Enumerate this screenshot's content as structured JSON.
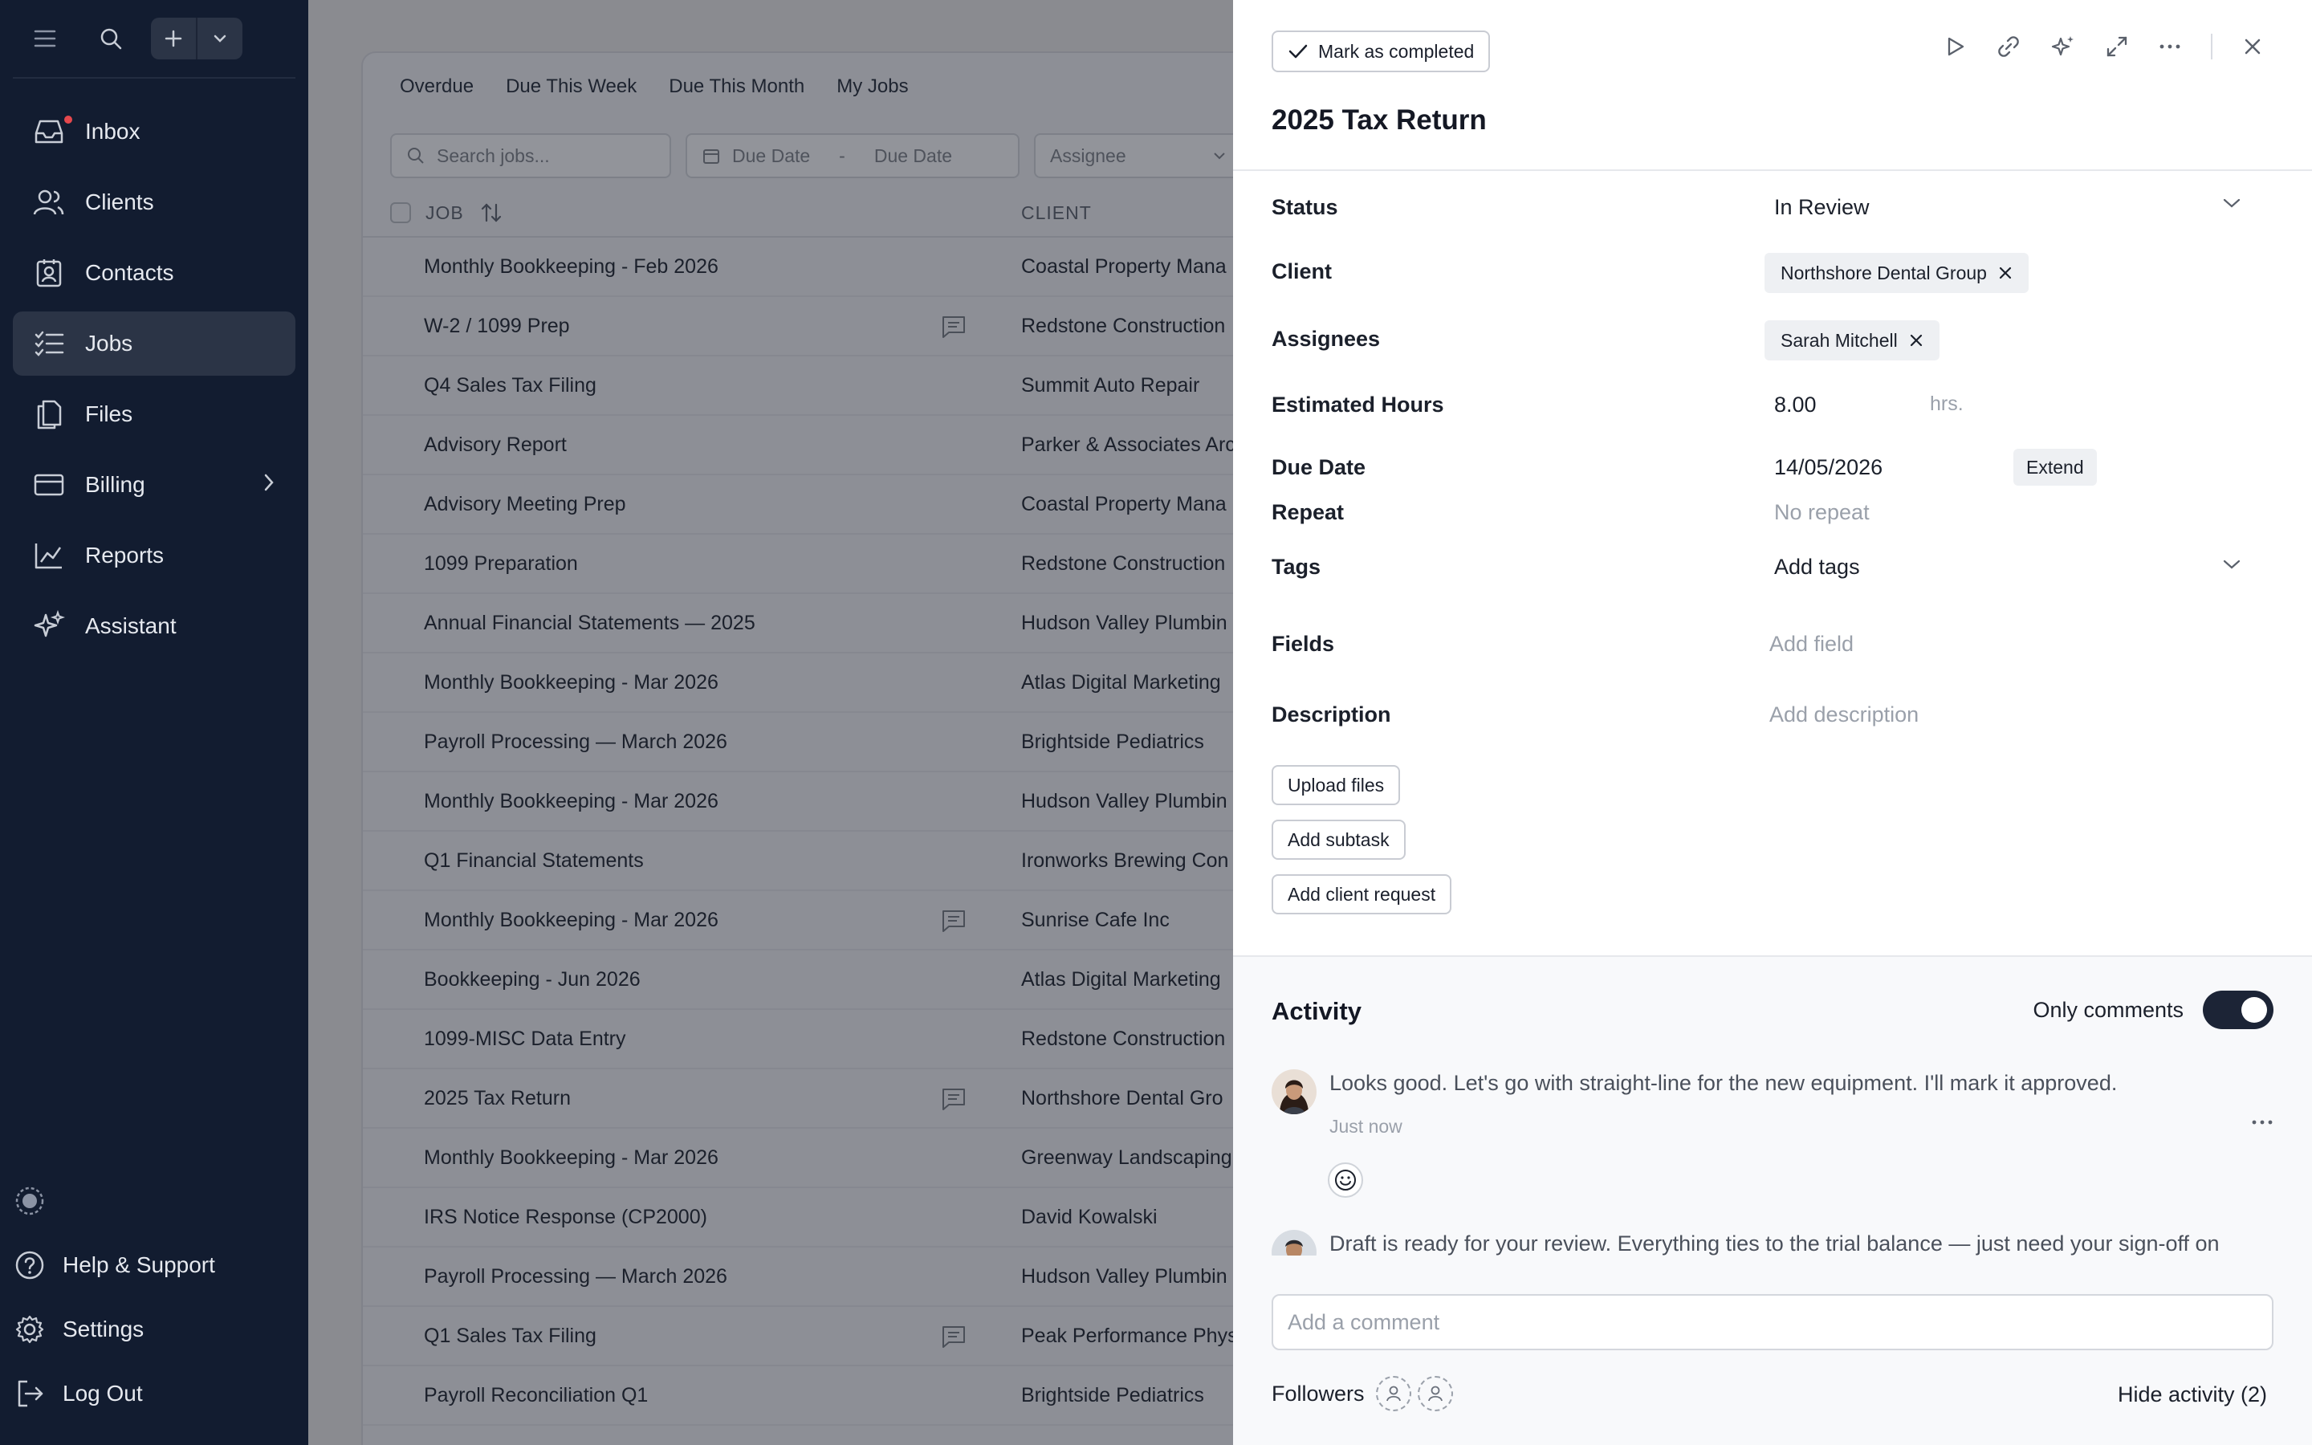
{
  "sidebar": {
    "nav": [
      {
        "label": "Inbox",
        "icon": "inbox-icon"
      },
      {
        "label": "Clients",
        "icon": "clients-icon"
      },
      {
        "label": "Contacts",
        "icon": "contacts-icon"
      },
      {
        "label": "Jobs",
        "icon": "jobs-icon"
      },
      {
        "label": "Files",
        "icon": "files-icon"
      },
      {
        "label": "Billing",
        "icon": "billing-icon"
      },
      {
        "label": "Reports",
        "icon": "reports-icon"
      },
      {
        "label": "Assistant",
        "icon": "assistant-icon"
      }
    ],
    "bottom": [
      {
        "label": "Help & Support",
        "icon": "help-icon"
      },
      {
        "label": "Settings",
        "icon": "gear-icon"
      },
      {
        "label": "Log Out",
        "icon": "logout-icon"
      }
    ]
  },
  "jobs": {
    "tabs": [
      "Overdue",
      "Due This Week",
      "Due This Month",
      "My Jobs"
    ],
    "search_placeholder": "Search jobs...",
    "due_from": "Due Date",
    "due_sep": "-",
    "due_to": "Due Date",
    "assignee": "Assignee",
    "col_job": "JOB",
    "col_client": "CLIENT",
    "rows": [
      {
        "job": "Monthly Bookkeeping - Feb 2026",
        "client": "Coastal Property Mana",
        "comment": false
      },
      {
        "job": "W-2 / 1099 Prep",
        "client": "Redstone Construction",
        "comment": true
      },
      {
        "job": "Q4 Sales Tax Filing",
        "client": "Summit Auto Repair",
        "comment": false
      },
      {
        "job": "Advisory Report",
        "client": "Parker & Associates Arc",
        "comment": false
      },
      {
        "job": "Advisory Meeting Prep",
        "client": "Coastal Property Mana",
        "comment": false
      },
      {
        "job": "1099 Preparation",
        "client": "Redstone Construction",
        "comment": false
      },
      {
        "job": "Annual Financial Statements — 2025",
        "client": "Hudson Valley Plumbin",
        "comment": false
      },
      {
        "job": "Monthly Bookkeeping - Mar 2026",
        "client": "Atlas Digital Marketing",
        "comment": false
      },
      {
        "job": "Payroll Processing — March 2026",
        "client": "Brightside Pediatrics",
        "comment": false
      },
      {
        "job": "Monthly Bookkeeping - Mar 2026",
        "client": "Hudson Valley Plumbin",
        "comment": false
      },
      {
        "job": "Q1 Financial Statements",
        "client": "Ironworks Brewing Con",
        "comment": false
      },
      {
        "job": "Monthly Bookkeeping - Mar 2026",
        "client": "Sunrise Cafe Inc",
        "comment": true
      },
      {
        "job": "Bookkeeping - Jun 2026",
        "client": "Atlas Digital Marketing",
        "comment": false
      },
      {
        "job": "1099-MISC Data Entry",
        "client": "Redstone Construction",
        "comment": false
      },
      {
        "job": "2025 Tax Return",
        "client": "Northshore Dental Gro",
        "comment": true
      },
      {
        "job": "Monthly Bookkeeping - Mar 2026",
        "client": "Greenway Landscaping",
        "comment": false
      },
      {
        "job": "IRS Notice Response (CP2000)",
        "client": "David Kowalski",
        "comment": false
      },
      {
        "job": "Payroll Processing — March 2026",
        "client": "Hudson Valley Plumbin",
        "comment": false
      },
      {
        "job": "Q1 Sales Tax Filing",
        "client": "Peak Performance Phys",
        "comment": true
      },
      {
        "job": "Payroll Reconciliation Q1",
        "client": "Brightside Pediatrics",
        "comment": false
      }
    ]
  },
  "detail": {
    "mark_completed": "Mark as completed",
    "title": "2025 Tax Return",
    "fields": {
      "status_label": "Status",
      "status_value": "In Review",
      "client_label": "Client",
      "client_value": "Northshore Dental Group",
      "assignees_label": "Assignees",
      "assignee_value": "Sarah Mitchell",
      "hours_label": "Estimated Hours",
      "hours_value": "8.00",
      "hours_unit": "hrs.",
      "due_label": "Due Date",
      "due_value": "14/05/2026",
      "extend": "Extend",
      "repeat_label": "Repeat",
      "repeat_value": "No repeat",
      "tags_label": "Tags",
      "tags_value": "Add tags",
      "fields_label": "Fields",
      "fields_value": "Add field",
      "desc_label": "Description",
      "desc_value": "Add description"
    },
    "buttons": {
      "upload": "Upload files",
      "subtask": "Add subtask",
      "client_request": "Add client request"
    }
  },
  "activity": {
    "title": "Activity",
    "only_comments": "Only comments",
    "only_comments_on": true,
    "comments": [
      {
        "text": "Looks good. Let's go with straight-line for the new equipment. I'll mark it approved.",
        "time": "Just now"
      },
      {
        "text": "Draft is ready for your review. Everything ties to the trial balance — just need your sign-off on",
        "time": ""
      }
    ],
    "add_comment_placeholder": "Add a comment",
    "followers_label": "Followers",
    "hide_activity": "Hide activity (2)"
  },
  "colors": {
    "sidebar_bg": "#121c30",
    "accent_dark": "#1c2436",
    "inbox_badge": "#e5484d"
  }
}
